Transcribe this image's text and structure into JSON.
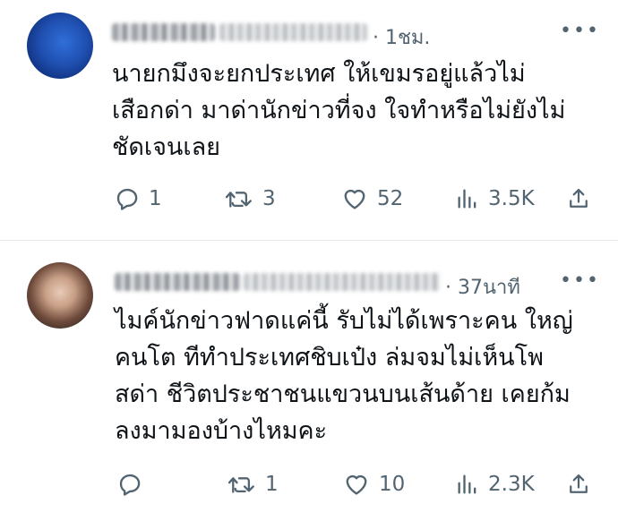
{
  "tweets": [
    {
      "time": "1ชม.",
      "text": "นายกมึงจะยกประเทศ ให้เขมรอยู่แล้วไม่\nเสือกด่า มาด่านักข่าวที่จง ใจทำหรือไม่ยังไม่\nชัดเจนเลย",
      "more": "•••",
      "replies": "1",
      "retweets": "3",
      "likes": "52",
      "views": "3.5K"
    },
    {
      "time": "37นาที",
      "text": "ไมค์นักข่าวฟาดแค่นี้ รับไม่ได้เพราะคน ใหญ่\nคนโต ทีทำประเทศชิบเป๋ง ล่มจมไม่เห็นโพ\nสด่า ชีวิตประชาชนแขวนบนเส้นด้าย เคยก้ม\nลงมามองบ้างไหมคะ",
      "more": "•••",
      "replies": "",
      "retweets": "1",
      "likes": "10",
      "views": "2.3K"
    }
  ],
  "icons": {
    "reply": "reply-icon",
    "retweet": "retweet-icon",
    "like": "heart-icon",
    "views": "views-icon",
    "share": "share-icon",
    "more": "more-icon"
  }
}
